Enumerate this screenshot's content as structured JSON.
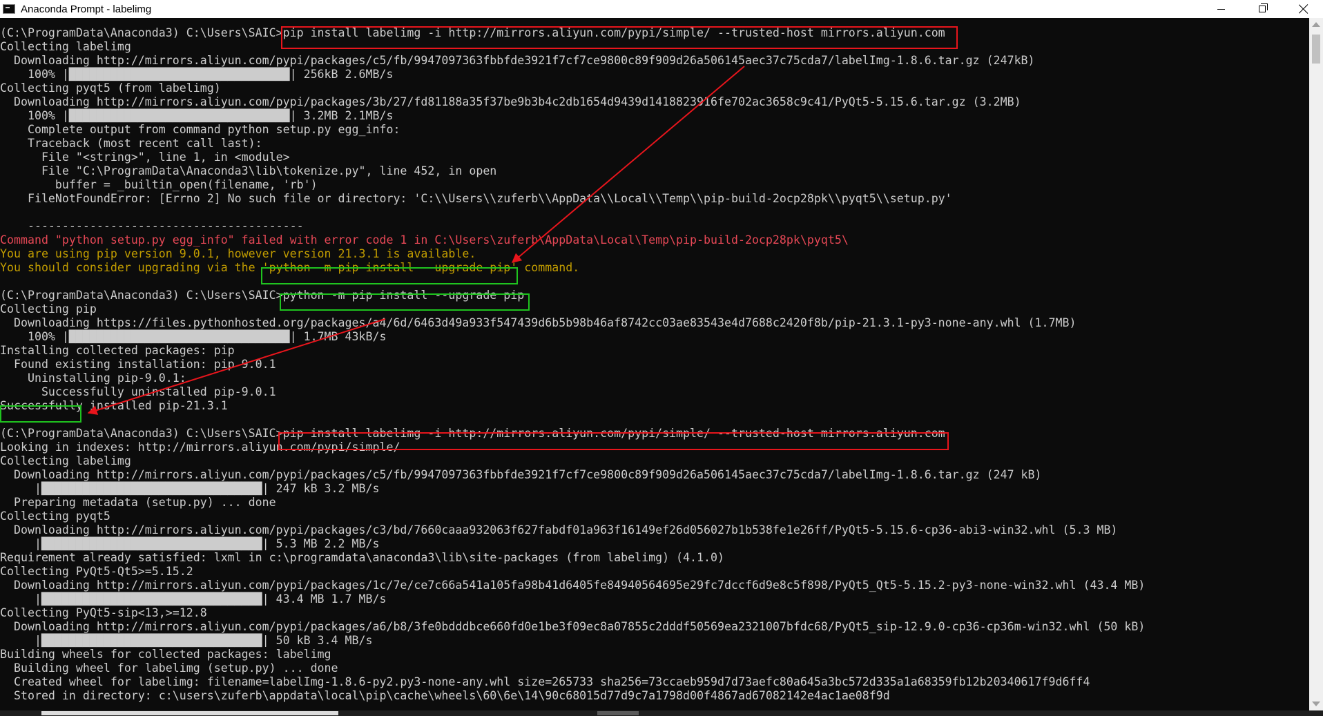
{
  "window": {
    "title": "Anaconda Prompt - labelimg",
    "icon": "console-icon"
  },
  "console": {
    "lines": [
      {
        "type": "cmd",
        "text": "(C:\\ProgramData\\Anaconda3) C:\\Users\\SAIC>pip install labelimg -i http://mirrors.aliyun.com/pypi/simple/ --trusted-host mirrors.aliyun.com"
      },
      {
        "type": "out",
        "text": "Collecting labelimg"
      },
      {
        "type": "out",
        "text": "  Downloading http://mirrors.aliyun.com/pypi/packages/c5/fb/9947097363fbbfde3921f7cf7ce9800c89f909d26a506145aec37c75cda7/labelImg-1.8.6.tar.gz (247kB)"
      },
      {
        "type": "out",
        "text": "    100% |████████████████████████████████| 256kB 2.6MB/s"
      },
      {
        "type": "out",
        "text": "Collecting pyqt5 (from labelimg)"
      },
      {
        "type": "out",
        "text": "  Downloading http://mirrors.aliyun.com/pypi/packages/3b/27/fd81188a35f37be9b3b4c2db1654d9439d1418823916fe702ac3658c9c41/PyQt5-5.15.6.tar.gz (3.2MB)"
      },
      {
        "type": "out",
        "text": "    100% |████████████████████████████████| 3.2MB 2.1MB/s"
      },
      {
        "type": "out",
        "text": "    Complete output from command python setup.py egg_info:"
      },
      {
        "type": "out",
        "text": "    Traceback (most recent call last):"
      },
      {
        "type": "out",
        "text": "      File \"<string>\", line 1, in <module>"
      },
      {
        "type": "out",
        "text": "      File \"C:\\ProgramData\\Anaconda3\\lib\\tokenize.py\", line 452, in open"
      },
      {
        "type": "out",
        "text": "        buffer = _builtin_open(filename, 'rb')"
      },
      {
        "type": "out",
        "text": "    FileNotFoundError: [Errno 2] No such file or directory: 'C:\\\\Users\\\\zuferb\\\\AppData\\\\Local\\\\Temp\\\\pip-build-2ocp28pk\\\\pyqt5\\\\setup.py'"
      },
      {
        "type": "out",
        "text": ""
      },
      {
        "type": "out",
        "text": "    ----------------------------------------"
      },
      {
        "type": "err",
        "text": "Command \"python setup.py egg_info\" failed with error code 1 in C:\\Users\\zuferb\\AppData\\Local\\Temp\\pip-build-2ocp28pk\\pyqt5\\"
      },
      {
        "type": "warn",
        "text": "You are using pip version 9.0.1, however version 21.3.1 is available."
      },
      {
        "type": "warn",
        "text": "You should consider upgrading via the 'python -m pip install --upgrade pip' command."
      },
      {
        "type": "out",
        "text": ""
      },
      {
        "type": "cmd",
        "text": "(C:\\ProgramData\\Anaconda3) C:\\Users\\SAIC>python -m pip install --upgrade pip"
      },
      {
        "type": "out",
        "text": "Collecting pip"
      },
      {
        "type": "out",
        "text": "  Downloading https://files.pythonhosted.org/packages/a4/6d/6463d49a933f547439d6b5b98b46af8742cc03ae83543e4d7688c2420f8b/pip-21.3.1-py3-none-any.whl (1.7MB)"
      },
      {
        "type": "out",
        "text": "    100% |████████████████████████████████| 1.7MB 43kB/s"
      },
      {
        "type": "out",
        "text": "Installing collected packages: pip"
      },
      {
        "type": "out",
        "text": "  Found existing installation: pip 9.0.1"
      },
      {
        "type": "out",
        "text": "    Uninstalling pip-9.0.1:"
      },
      {
        "type": "out",
        "text": "      Successfully uninstalled pip-9.0.1"
      },
      {
        "type": "out",
        "text": "Successfully installed pip-21.3.1"
      },
      {
        "type": "out",
        "text": ""
      },
      {
        "type": "cmd",
        "text": "(C:\\ProgramData\\Anaconda3) C:\\Users\\SAIC>pip install labelimg -i http://mirrors.aliyun.com/pypi/simple/ --trusted-host mirrors.aliyun.com"
      },
      {
        "type": "out",
        "text": "Looking in indexes: http://mirrors.aliyun.com/pypi/simple/"
      },
      {
        "type": "out",
        "text": "Collecting labelimg"
      },
      {
        "type": "out",
        "text": "  Downloading http://mirrors.aliyun.com/pypi/packages/c5/fb/9947097363fbbfde3921f7cf7ce9800c89f909d26a506145aec37c75cda7/labelImg-1.8.6.tar.gz (247 kB)"
      },
      {
        "type": "out",
        "text": "     |████████████████████████████████| 247 kB 3.2 MB/s"
      },
      {
        "type": "out",
        "text": "  Preparing metadata (setup.py) ... done"
      },
      {
        "type": "out",
        "text": "Collecting pyqt5"
      },
      {
        "type": "out",
        "text": "  Downloading http://mirrors.aliyun.com/pypi/packages/c3/bd/7660caaa932063f627fabdf01a963f16149ef26d056027b1b538fe1e26ff/PyQt5-5.15.6-cp36-abi3-win32.whl (5.3 MB)"
      },
      {
        "type": "out",
        "text": "     |████████████████████████████████| 5.3 MB 2.2 MB/s"
      },
      {
        "type": "out",
        "text": "Requirement already satisfied: lxml in c:\\programdata\\anaconda3\\lib\\site-packages (from labelimg) (4.1.0)"
      },
      {
        "type": "out",
        "text": "Collecting PyQt5-Qt5>=5.15.2"
      },
      {
        "type": "out",
        "text": "  Downloading http://mirrors.aliyun.com/pypi/packages/1c/7e/ce7c66a541a105fa98b41d6405fe84940564695e29fc7dccf6d9e8c5f898/PyQt5_Qt5-5.15.2-py3-none-win32.whl (43.4 MB)"
      },
      {
        "type": "out",
        "text": "     |████████████████████████████████| 43.4 MB 1.7 MB/s"
      },
      {
        "type": "out",
        "text": "Collecting PyQt5-sip<13,>=12.8"
      },
      {
        "type": "out",
        "text": "  Downloading http://mirrors.aliyun.com/pypi/packages/a6/b8/3fe0bdddbce660fd0e1be3f09ec8a07855c2dddf50569ea2321007bfdc68/PyQt5_sip-12.9.0-cp36-cp36m-win32.whl (50 kB)"
      },
      {
        "type": "out",
        "text": "     |████████████████████████████████| 50 kB 3.4 MB/s"
      },
      {
        "type": "out",
        "text": "Building wheels for collected packages: labelimg"
      },
      {
        "type": "out",
        "text": "  Building wheel for labelimg (setup.py) ... done"
      },
      {
        "type": "out",
        "text": "  Created wheel for labelimg: filename=labelImg-1.8.6-py2.py3-none-any.whl size=265733 sha256=73ccaeb959d7d73aefc80a645a3bc572d335a1a68359fb12b20340617f9d6ff4"
      },
      {
        "type": "out",
        "text": "  Stored in directory: c:\\users\\zuferb\\appdata\\local\\pip\\cache\\wheels\\60\\6e\\14\\90c68015d77d9c7a1798d00f4867ad67082142e4ac1ae08f9d"
      }
    ]
  },
  "colors": {
    "background": "#0c0c0c",
    "text": "#cccccc",
    "error": "#e74856",
    "warning": "#c19c00",
    "highlight_red": "#e8151c",
    "highlight_green": "#1fc31f",
    "arrow": "#e8151c"
  }
}
